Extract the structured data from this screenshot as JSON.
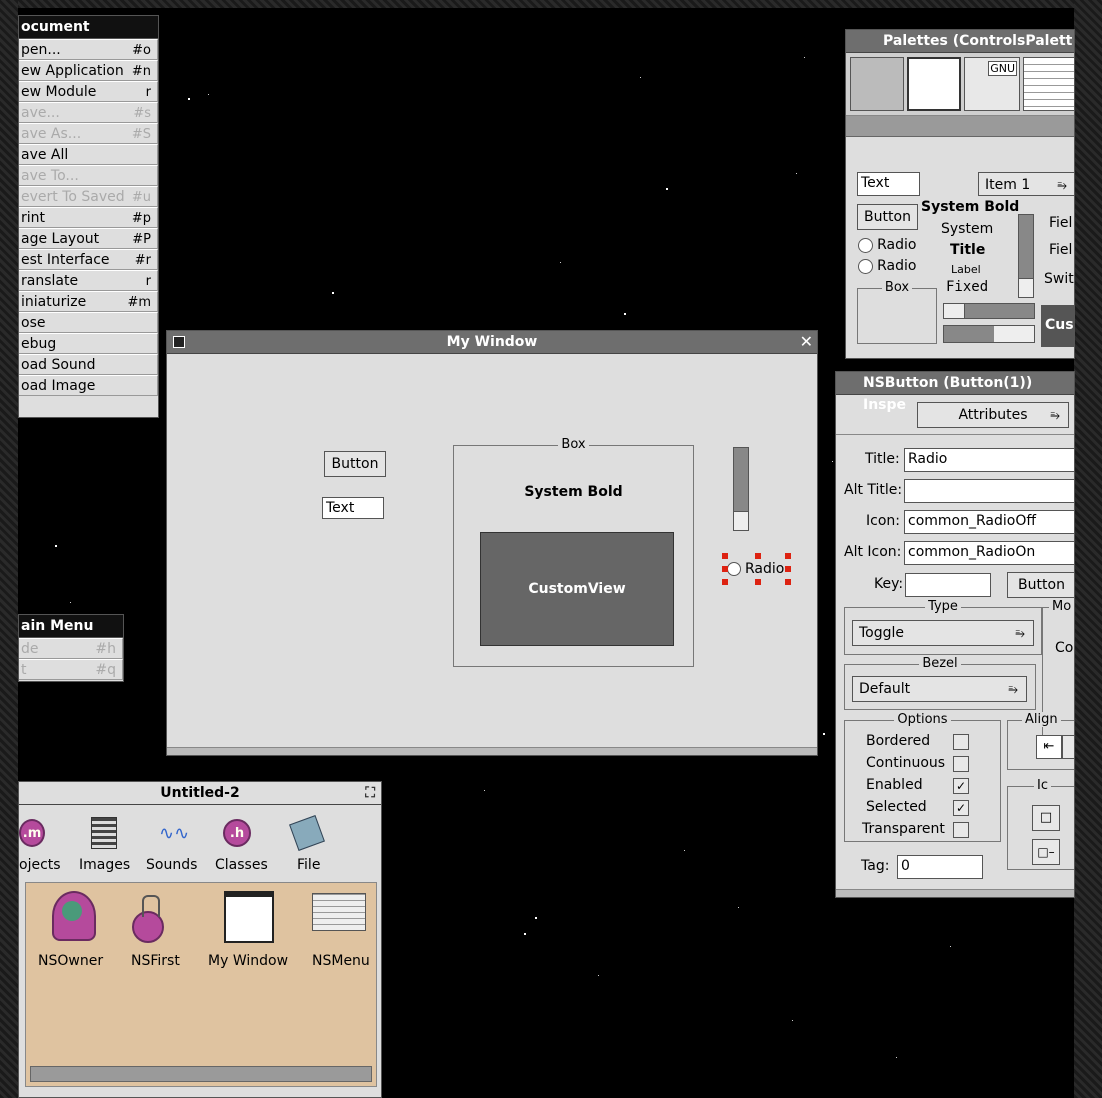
{
  "document_menu": {
    "title": "ocument",
    "items": [
      {
        "label": "pen...",
        "key": "#o",
        "enabled": true
      },
      {
        "label": "ew Application",
        "key": "#n",
        "enabled": true
      },
      {
        "label": "ew Module",
        "key": "r",
        "enabled": true
      },
      {
        "label": "ave...",
        "key": "#s",
        "enabled": false
      },
      {
        "label": "ave As...",
        "key": "#S",
        "enabled": false
      },
      {
        "label": "ave All",
        "key": "",
        "enabled": true
      },
      {
        "label": "ave To...",
        "key": "",
        "enabled": false
      },
      {
        "label": "evert To Saved",
        "key": "#u",
        "enabled": false
      },
      {
        "label": "rint",
        "key": "#p",
        "enabled": true
      },
      {
        "label": "age Layout",
        "key": "#P",
        "enabled": true
      },
      {
        "label": "est Interface",
        "key": "#r",
        "enabled": true
      },
      {
        "label": "ranslate",
        "key": "r",
        "enabled": true
      },
      {
        "label": "iniaturize",
        "key": "#m",
        "enabled": true
      },
      {
        "label": "ose",
        "key": "",
        "enabled": true
      },
      {
        "label": "ebug",
        "key": "",
        "enabled": true
      },
      {
        "label": "oad Sound",
        "key": "",
        "enabled": true
      },
      {
        "label": "oad Image",
        "key": "",
        "enabled": true
      }
    ]
  },
  "main_menu": {
    "title": "ain Menu",
    "items": [
      {
        "label": "de",
        "key": "#h"
      },
      {
        "label": "t",
        "key": "#q"
      }
    ]
  },
  "my_window": {
    "title": "My Window",
    "button_label": "Button",
    "text_value": "Text",
    "box_title": "Box",
    "system_bold": "System Bold",
    "custom_view": "CustomView",
    "radio_label": "Radio"
  },
  "palettes": {
    "title": "Palettes (ControlsPalett",
    "gnu": "GNU",
    "text_field": "Text",
    "popup": "Item 1",
    "button": "Button",
    "system_bold": "System Bold",
    "system": "System",
    "title_font": "Title",
    "label_font": "Label",
    "fixed_font": "Fixed",
    "radio1": "Radio",
    "radio2": "Radio",
    "box": "Box",
    "field1": "Fiel",
    "field2": "Fiel",
    "switch": "Swit",
    "custom": "Cus"
  },
  "inspector": {
    "title": "NSButton (Button(1)) Inspe",
    "mode": "Attributes",
    "title_label": "Title:",
    "title_value": "Radio",
    "alt_title_label": "Alt Title:",
    "alt_title_value": "",
    "icon_label": "Icon:",
    "icon_value": "common_RadioOff",
    "alt_icon_label": "Alt Icon:",
    "alt_icon_value": "common_RadioOn",
    "key_label": "Key:",
    "key_value": "",
    "key_button": "Button",
    "type_title": "Type",
    "type_value": "Toggle",
    "mode_title": "Mo",
    "mode_cut": "Co",
    "bezel_title": "Bezel",
    "bezel_value": "Default",
    "options_title": "Options",
    "options": [
      {
        "label": "Bordered",
        "checked": false
      },
      {
        "label": "Continuous",
        "checked": false
      },
      {
        "label": "Enabled",
        "checked": true
      },
      {
        "label": "Selected",
        "checked": true
      },
      {
        "label": "Transparent",
        "checked": false
      }
    ],
    "align_title": "Align",
    "icon_pos_title": "Ic",
    "tag_label": "Tag:",
    "tag_value": "0"
  },
  "untitled": {
    "title": "Untitled-2",
    "tabs": [
      {
        "label": "ojects",
        "icon": "objects-icon"
      },
      {
        "label": "Images",
        "icon": "images-icon"
      },
      {
        "label": "Sounds",
        "icon": "sounds-icon"
      },
      {
        "label": "Classes",
        "icon": "classes-icon"
      },
      {
        "label": "File",
        "icon": "file-icon"
      }
    ],
    "objects": [
      {
        "label": "NSOwner"
      },
      {
        "label": "NSFirst"
      },
      {
        "label": "My Window"
      },
      {
        "label": "NSMenu"
      }
    ],
    "tab_m": ".m",
    "tab_h": ".h"
  }
}
